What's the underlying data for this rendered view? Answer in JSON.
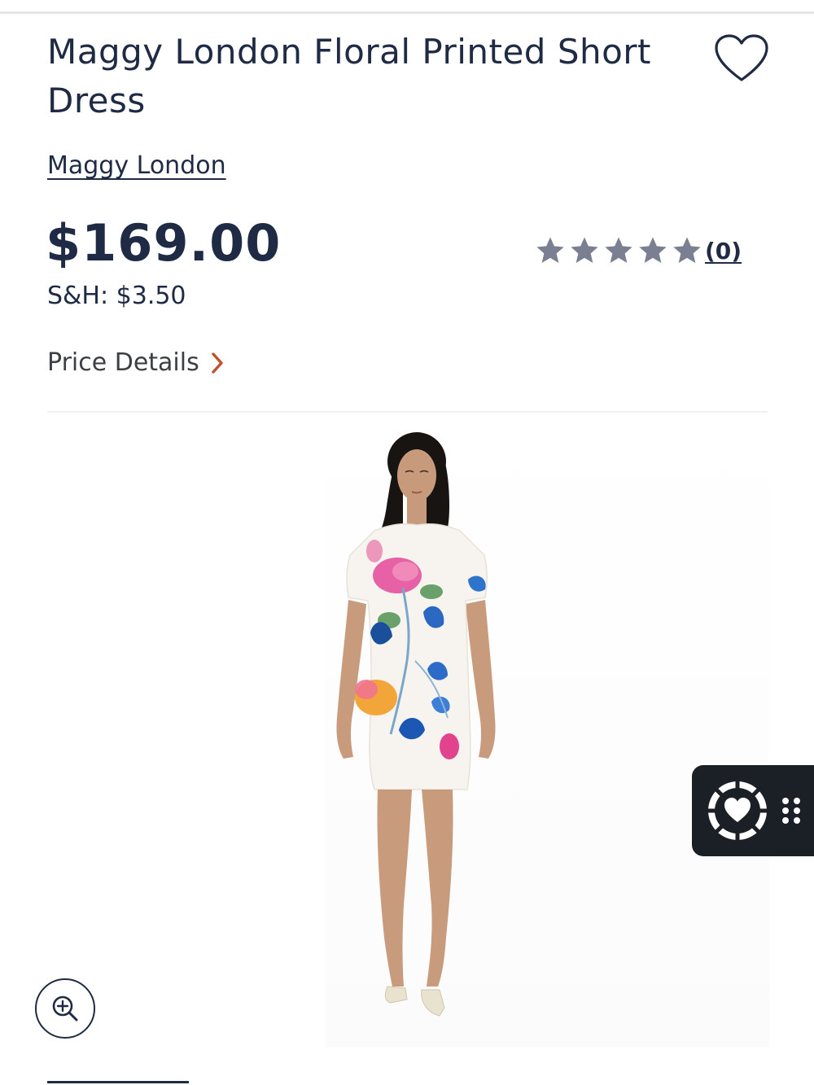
{
  "product": {
    "title": "Maggy London Floral Printed Short Dress",
    "brand": "Maggy London",
    "price": "$169.00",
    "shipping": "S&H: $3.50",
    "rating_stars": 5,
    "rating_count": "(0)",
    "price_details_label": "Price Details"
  },
  "icons": {
    "favorite": "heart-outline-icon",
    "price_details_arrow": "chevron-right-icon",
    "zoom": "zoom-in-icon",
    "widget": "heart-wheel-icon",
    "widget_handle": "drag-dots-icon",
    "rating": "star-icon"
  },
  "colors": {
    "text_primary": "#1f2a44",
    "star": "#7a8091",
    "chevron": "#c2502a",
    "widget_bg": "#1b1f26"
  }
}
